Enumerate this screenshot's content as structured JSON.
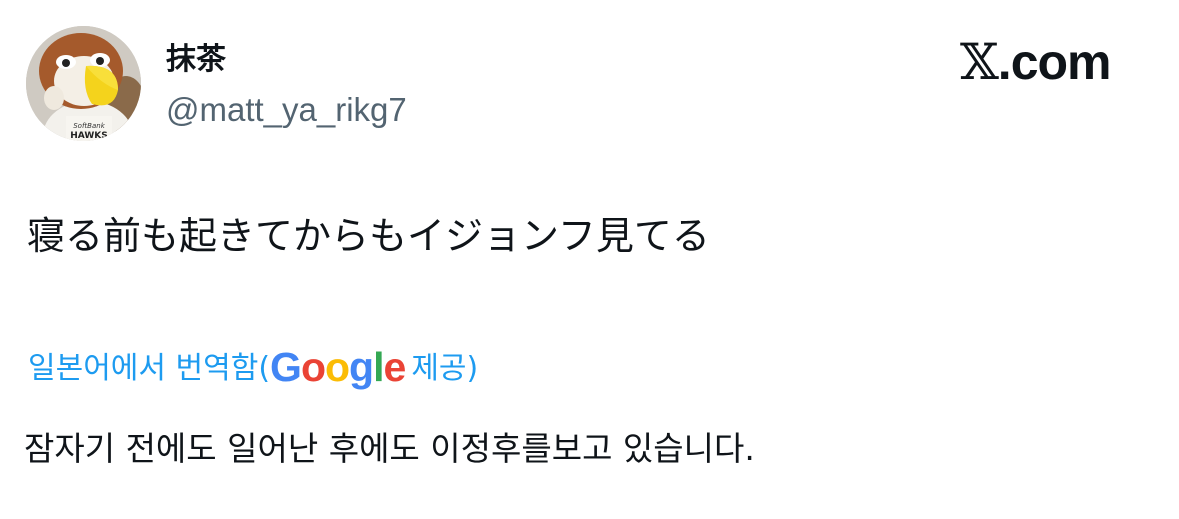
{
  "author": {
    "display_name": "抹茶",
    "handle": "@matt_ya_rikg7",
    "avatar_icon": "bird-mascot-avatar"
  },
  "brand": {
    "x_glyph": "𝕏",
    "suffix": ".com"
  },
  "tweet": {
    "text": "寝る前も起きてからもイジョンフ見てる"
  },
  "translation": {
    "label": "일본어에서 번역함(",
    "google_letters": [
      {
        "ch": "G",
        "color": "#4285F4"
      },
      {
        "ch": "o",
        "color": "#EA4335"
      },
      {
        "ch": "o",
        "color": "#FBBC05"
      },
      {
        "ch": "g",
        "color": "#4285F4"
      },
      {
        "ch": "l",
        "color": "#34A853"
      },
      {
        "ch": "e",
        "color": "#EA4335"
      }
    ],
    "provided": "제공)",
    "text": "잠자기 전에도 일어난 후에도 이정후를보고 있습니다."
  },
  "colors": {
    "link": "#1d9bf0",
    "secondary_text": "#536471",
    "primary_text": "#0f1419"
  }
}
